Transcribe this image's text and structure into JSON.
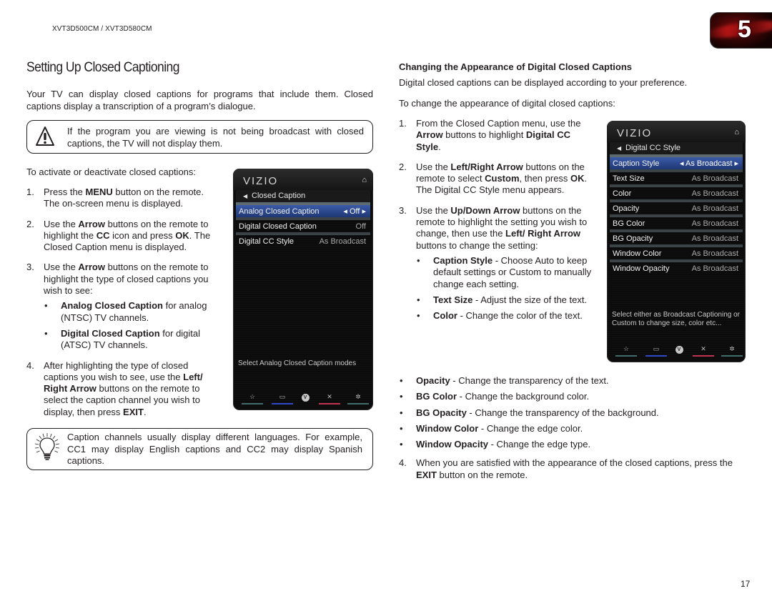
{
  "header": {
    "model": "XVT3D500CM / XVT3D580CM",
    "chapter": "5"
  },
  "left": {
    "title": "Setting Up Closed Captioning",
    "intro": "Your TV can display closed captions for programs that include them. Closed captions display a transcription of a program’s dialogue.",
    "warning": {
      "icon": "warning-triangle-icon",
      "text": "If the program you are viewing is not being broadcast with closed captions, the TV will not display them."
    },
    "lead": "To activate or deactivate closed captions:",
    "steps": [
      {
        "n": "1.",
        "parts": [
          [
            "Press the ",
            false
          ],
          [
            "MENU",
            true
          ],
          [
            " button on the remote. The on-screen menu is displayed.",
            false
          ]
        ]
      },
      {
        "n": "2.",
        "parts": [
          [
            "Use the ",
            false
          ],
          [
            "Arrow",
            true
          ],
          [
            " buttons on the remote to highlight the ",
            false
          ],
          [
            "CC",
            true
          ],
          [
            " icon and press ",
            false
          ],
          [
            "OK",
            true
          ],
          [
            ". The Closed Caption menu is displayed.",
            false
          ]
        ]
      },
      {
        "n": "3.",
        "parts": [
          [
            "Use the ",
            false
          ],
          [
            "Arrow",
            true
          ],
          [
            " buttons on the remote to highlight the type of closed captions you wish to see:",
            false
          ]
        ],
        "bullets": [
          [
            [
              "Analog Closed Caption",
              true
            ],
            [
              " for analog (NTSC) TV channels.",
              false
            ]
          ],
          [
            [
              "Digital Closed Caption",
              true
            ],
            [
              " for digital (ATSC) TV channels.",
              false
            ]
          ]
        ]
      },
      {
        "n": "4.",
        "parts": [
          [
            "After highlighting the type of closed captions you wish to see, use the ",
            false
          ],
          [
            "Left/ Right Arrow",
            true
          ],
          [
            " buttons on the remote to select the caption channel you wish to display, then press ",
            false
          ],
          [
            "EXIT",
            true
          ],
          [
            ".",
            false
          ]
        ]
      }
    ],
    "tip": {
      "icon": "lightbulb-icon",
      "text": "Caption channels usually display different languages. For example, CC1 may display English captions and CC2 may display Spanish captions."
    }
  },
  "tv_menu_1": {
    "logo": "VIZIO",
    "breadcrumb": "Closed Caption",
    "rows": [
      {
        "label": "Analog Closed Caption",
        "value": "Off",
        "selected": true
      },
      {
        "label": "Digital Closed Caption",
        "value": "Off",
        "selected": false
      },
      {
        "label": "Digital CC Style",
        "value": "As Broadcast",
        "selected": false
      }
    ],
    "help": "Select Analog Closed Caption modes",
    "bottom_buttons": [
      {
        "icon": "star-icon",
        "glyph": "☆",
        "color": "#3f6b6b"
      },
      {
        "icon": "cc-icon",
        "glyph": "▭",
        "color": "#2e48c8"
      },
      {
        "icon": "vizio-v-icon",
        "glyph": "V",
        "color": ""
      },
      {
        "icon": "close-icon",
        "glyph": "✕",
        "color": "#c0304f"
      },
      {
        "icon": "gear-icon",
        "glyph": "✲",
        "color": "#3f6b6b"
      }
    ]
  },
  "right": {
    "heading": "Changing the Appearance of Digital Closed Captions",
    "p1": "Digital closed captions can be displayed according to your preference.",
    "p2": "To change the appearance of digital closed captions:",
    "steps": [
      {
        "n": "1.",
        "parts": [
          [
            "From the Closed Caption menu, use the ",
            false
          ],
          [
            "Arrow",
            true
          ],
          [
            " buttons to highlight ",
            false
          ],
          [
            "Digital CC Style",
            true
          ],
          [
            ".",
            false
          ]
        ]
      },
      {
        "n": "2.",
        "parts": [
          [
            "Use the ",
            false
          ],
          [
            "Left/Right Arrow",
            true
          ],
          [
            " buttons on the remote to select ",
            false
          ],
          [
            "Custom",
            true
          ],
          [
            ", then press ",
            false
          ],
          [
            "OK",
            true
          ],
          [
            ". The Digital CC Style menu appears.",
            false
          ]
        ]
      },
      {
        "n": "3.",
        "parts": [
          [
            "Use the ",
            false
          ],
          [
            "Up/Down Arrow",
            true
          ],
          [
            " buttons on the remote to highlight the setting you wish to change, then use the ",
            false
          ],
          [
            "Left/ Right Arrow",
            true
          ],
          [
            " buttons to change the setting:",
            false
          ]
        ],
        "bullets": [
          [
            [
              "Caption Style",
              true
            ],
            [
              " - Choose Auto to keep default settings or Custom to manually change each setting.",
              false
            ]
          ],
          [
            [
              "Text Size",
              true
            ],
            [
              " - Adjust the size of the text.",
              false
            ]
          ],
          [
            [
              "Color",
              true
            ],
            [
              " - Change the color of the text.",
              false
            ]
          ]
        ]
      }
    ],
    "wide_bullets": [
      [
        [
          "Opacity",
          true
        ],
        [
          " - Change the transparency of the text.",
          false
        ]
      ],
      [
        [
          "BG Color",
          true
        ],
        [
          " - Change the background color.",
          false
        ]
      ],
      [
        [
          "BG Opacity",
          true
        ],
        [
          " - Change the transparency of the background.",
          false
        ]
      ],
      [
        [
          "Window Color",
          true
        ],
        [
          " - Change the edge color.",
          false
        ]
      ],
      [
        [
          "Window Opacity",
          true
        ],
        [
          " - Change the edge type.",
          false
        ]
      ]
    ],
    "step4": {
      "n": "4.",
      "parts": [
        [
          "When you are satisfied with the appearance of the closed captions, press the ",
          false
        ],
        [
          "EXIT",
          true
        ],
        [
          " button on the remote.",
          false
        ]
      ]
    }
  },
  "tv_menu_2": {
    "logo": "VIZIO",
    "breadcrumb": "Digital CC Style",
    "rows": [
      {
        "label": "Caption Style",
        "value": "As Broadcast",
        "selected": true
      },
      {
        "label": "Text Size",
        "value": "As Broadcast",
        "selected": false
      },
      {
        "label": "Color",
        "value": "As Broadcast",
        "selected": false
      },
      {
        "label": "Opacity",
        "value": "As Broadcast",
        "selected": false
      },
      {
        "label": "BG Color",
        "value": "As Broadcast",
        "selected": false
      },
      {
        "label": "BG Opacity",
        "value": "As Broadcast",
        "selected": false
      },
      {
        "label": "Window Color",
        "value": "As Broadcast",
        "selected": false
      },
      {
        "label": "Window Opacity",
        "value": "As Broadcast",
        "selected": false
      }
    ],
    "help": "Select either as Broadcast Captioning or Custom to change size, color etc...",
    "bottom_buttons": [
      {
        "icon": "star-icon",
        "glyph": "☆",
        "color": "#3f6b6b"
      },
      {
        "icon": "cc-icon",
        "glyph": "▭",
        "color": "#2e48c8"
      },
      {
        "icon": "vizio-v-icon",
        "glyph": "V",
        "color": ""
      },
      {
        "icon": "close-icon",
        "glyph": "✕",
        "color": "#c0304f"
      },
      {
        "icon": "gear-icon",
        "glyph": "✲",
        "color": "#3f6b6b"
      }
    ]
  },
  "footer": {
    "page_number": "17"
  }
}
